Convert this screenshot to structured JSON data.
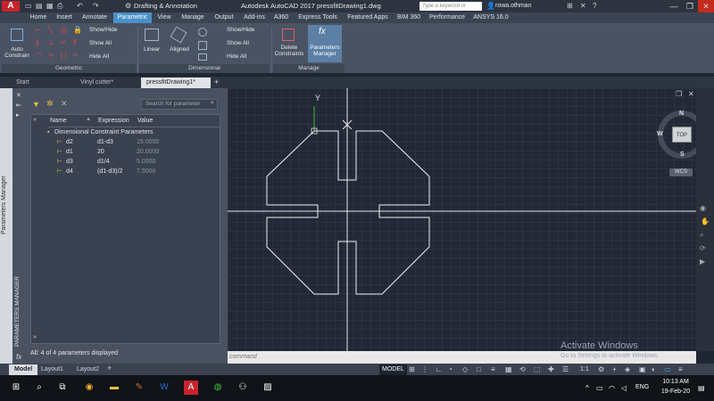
{
  "titlebar": {
    "logo": "A",
    "workspace": "Drafting & Annotation",
    "title": "Autodesk AutoCAD 2017   pressfitDrawing1.dwg",
    "search_placeholder": "Type a keyword or phrase",
    "user": "rowa.othman"
  },
  "ribbon_tabs": [
    "Home",
    "Insert",
    "Annotate",
    "Parametric",
    "View",
    "Manage",
    "Output",
    "Add-ins",
    "A360",
    "Express Tools",
    "Featured Apps",
    "BIM 360",
    "Performance",
    "ANSYS 16.0"
  ],
  "ribbon_active_tab": "Parametric",
  "ribbon": {
    "auto_constrain": "Auto Constrain",
    "show_hide_1": "Show/Hide",
    "show_all_1": "Show All",
    "hide_all_1": "Hide All",
    "linear": "Linear",
    "aligned": "Aligned",
    "show_hide_2": "Show/Hide",
    "show_all_2": "Show All",
    "hide_all_2": "Hide All",
    "delete_constraints": "Delete Constraints",
    "parameters_manager": "Parameters Manager",
    "panel_geometric": "Geometric",
    "panel_dimensional": "Dimensional",
    "panel_manage": "Manage"
  },
  "doc_tabs": [
    "Start",
    "Vinyl cutter*",
    "pressfitDrawing1*"
  ],
  "doc_tab_active": "pressfitDrawing1*",
  "params_manager": {
    "sidebar_label": "Parameters Manager",
    "panel_label": "PARAMETERS MANAGER",
    "search_placeholder": "Search for parameter",
    "columns": [
      "Name",
      "Expression",
      "Value"
    ],
    "group": "Dimensional Constraint Parameters",
    "rows": [
      {
        "name": "d2",
        "expression": "d1-d3",
        "value": "15.0000"
      },
      {
        "name": "d1",
        "expression": "20",
        "value": "20.0000"
      },
      {
        "name": "d3",
        "expression": "d1/4",
        "value": "5.0000"
      },
      {
        "name": "d4",
        "expression": "(d1-d3)/2",
        "value": "7.5000"
      }
    ],
    "status": "All: 4 of 4 parameters displayed",
    "fx": "fx"
  },
  "viewport": {
    "y_axis_label": "Y",
    "compass": {
      "n": "N",
      "s": "S",
      "e": "E",
      "w": "W",
      "face": "TOP",
      "wcs": "WCS"
    }
  },
  "command_placeholder": "command",
  "layout_tabs": [
    "Model",
    "Layout1",
    "Layout2"
  ],
  "layout_active": "Model",
  "status": {
    "model": "MODEL",
    "scale": "1:1"
  },
  "watermark": {
    "line1": "Activate Windows",
    "line2": "Go to Settings to activate Windows."
  },
  "taskbar": {
    "time": "10:13 AM",
    "date": "19-Feb-20",
    "lang": "ENG"
  },
  "colors": {
    "accent": "#4a90c8",
    "autocad_red": "#c8232c"
  }
}
